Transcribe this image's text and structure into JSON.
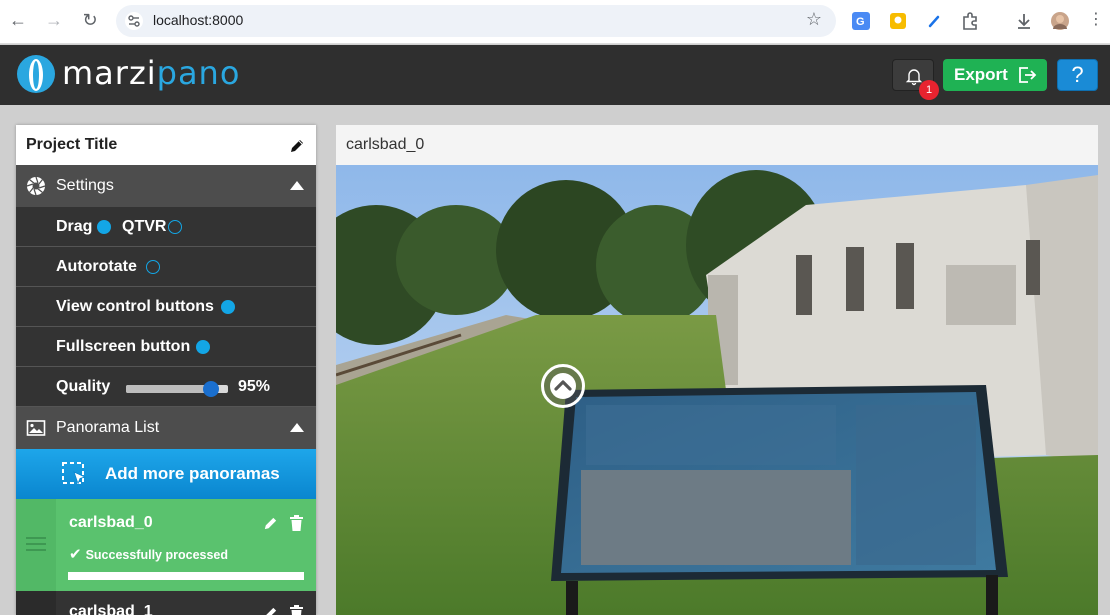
{
  "browser": {
    "url": "localhost:8000"
  },
  "header": {
    "logo_part1": "marzi",
    "logo_part2": "pano",
    "notification_count": "1",
    "export_label": "Export",
    "help_label": "?"
  },
  "sidebar": {
    "project_title": "Project Title",
    "settings": {
      "title": "Settings",
      "drag_label": "Drag",
      "qtvr_label": "QTVR",
      "autorotate_label": "Autorotate",
      "view_control_label": "View control buttons",
      "fullscreen_label": "Fullscreen button",
      "quality_label": "Quality",
      "quality_value": "95%",
      "quality_level": 0.9,
      "drag_selected": true,
      "qtvr_selected": false,
      "autorotate_enabled": false,
      "view_control_enabled": true,
      "fullscreen_enabled": true
    },
    "panorama_list": {
      "title": "Panorama List",
      "add_label": "Add more panoramas",
      "items": [
        {
          "name": "carlsbad_0",
          "status": "Successfully processed",
          "progress": 1.0
        },
        {
          "name": "carlsbad_1"
        }
      ]
    }
  },
  "viewer": {
    "title": "carlsbad_0"
  },
  "colors": {
    "accent_blue": "#13a6e6",
    "export_green": "#1fb254",
    "help_blue": "#1a8bd6",
    "success_green": "#5ac26e",
    "badge_red": "#e8232f"
  }
}
